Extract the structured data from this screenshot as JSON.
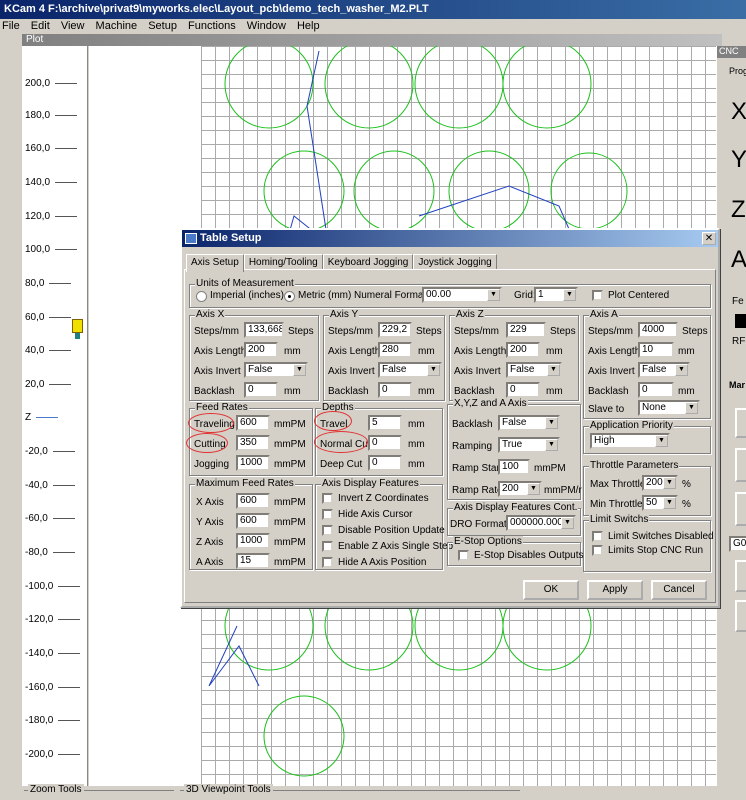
{
  "app": {
    "title": "KCam 4  F:\\archive\\privat9\\myworks.elec\\Layout_pcb\\demo_tech_washer_M2.PLT"
  },
  "menu": [
    "File",
    "Edit",
    "View",
    "Machine",
    "Setup",
    "Functions",
    "Window",
    "Help"
  ],
  "plot": {
    "title": "Plot",
    "ticks": [
      "200,0",
      "180,0",
      "160,0",
      "140,0",
      "120,0",
      "100,0",
      "80,0",
      "60,0",
      "40,0",
      "20,0",
      "Z",
      "-20,0",
      "-40,0",
      "-60,0",
      "-80,0",
      "-100,0",
      "-120,0",
      "-140,0",
      "-160,0",
      "-180,0",
      "-200,0"
    ]
  },
  "right_panel": {
    "title": "CNC",
    "prog": "Prog",
    "axes": [
      "X",
      "Y",
      "Z",
      "A"
    ],
    "fe": "Fe",
    "rf": "RF",
    "ma": "Mar",
    "g0": "G0"
  },
  "bottom": {
    "zoom_tools": "Zoom Tools",
    "viewpoint_tools": "3D Viewpoint Tools"
  },
  "dialog": {
    "title": "Table Setup",
    "tabs": [
      "Axis Setup",
      "Homing/Tooling",
      "Keyboard Jogging",
      "Joystick Jogging"
    ],
    "units": {
      "legend": "Units of Measurement",
      "imperial": "Imperial (inches)",
      "metric": "Metric (mm)",
      "numeral_label": "Numeral Format:",
      "numeral_value": "00.00",
      "grid_label": "Grid:",
      "grid_value": "1",
      "plot_centered": "Plot Centered"
    },
    "axis_x": {
      "legend": "Axis X",
      "steps_label": "Steps/mm",
      "steps": "133,668",
      "steps_unit": "Steps",
      "length_label": "Axis Length",
      "length": "200",
      "length_unit": "mm",
      "invert_label": "Axis Invert",
      "invert": "False",
      "backlash_label": "Backlash",
      "backlash": "0",
      "backlash_unit": "mm"
    },
    "axis_y": {
      "legend": "Axis Y",
      "steps_label": "Steps/mm",
      "steps": "229,2",
      "steps_unit": "Steps",
      "length_label": "Axis Length",
      "length": "280",
      "length_unit": "mm",
      "invert_label": "Axis Invert",
      "invert": "False",
      "backlash_label": "Backlash",
      "backlash": "0",
      "backlash_unit": "mm"
    },
    "axis_z": {
      "legend": "Axis Z",
      "steps_label": "Steps/mm",
      "steps": "229",
      "steps_unit": "Steps",
      "length_label": "Axis Length",
      "length": "200",
      "length_unit": "mm",
      "invert_label": "Axis Invert",
      "invert": "False",
      "backlash_label": "Backlash",
      "backlash": "0",
      "backlash_unit": "mm"
    },
    "axis_a": {
      "legend": "Axis A",
      "steps_label": "Steps/mm",
      "steps": "4000",
      "steps_unit": "Steps",
      "length_label": "Axis Length",
      "length": "10",
      "length_unit": "mm",
      "invert_label": "Axis Invert",
      "invert": "False",
      "backlash_label": "Backlash",
      "backlash": "0",
      "backlash_unit": "mm",
      "slave_label": "Slave to",
      "slave": "None"
    },
    "feed": {
      "legend": "Feed Rates",
      "traveling_label": "Traveling",
      "traveling": "600",
      "cutting_label": "Cutting",
      "cutting": "350",
      "jogging_label": "Jogging",
      "jogging": "1000",
      "unit": "mmPM"
    },
    "depths": {
      "legend": "Depths",
      "travel_label": "Travel",
      "travel": "5",
      "normal_label": "Normal Cut",
      "normal": "0",
      "deep_label": "Deep Cut",
      "deep": "0",
      "unit": "mm"
    },
    "xyz_a": {
      "legend": "X,Y,Z and A Axis",
      "backlash_label": "Backlash",
      "backlash": "False",
      "ramping_label": "Ramping",
      "ramping": "True",
      "ramp_start_label": "Ramp Start",
      "ramp_start": "100",
      "ramp_start_unit": "mmPM",
      "ramp_rate_label": "Ramp Rate",
      "ramp_rate": "200",
      "ramp_rate_unit": "mmPM/r"
    },
    "priority": {
      "legend": "Application Priority",
      "value": "High"
    },
    "throttle": {
      "legend": "Throttle Parameters",
      "max_label": "Max Throttle:",
      "max": "200",
      "min_label": "Min Throttle:",
      "min": "50",
      "unit": "%"
    },
    "max_feed": {
      "legend": "Maximum Feed Rates",
      "x_label": "X Axis",
      "x": "600",
      "y_label": "Y Axis",
      "y": "600",
      "z_label": "Z Axis",
      "z": "1000",
      "a_label": "A Axis",
      "a": "15",
      "unit": "mmPM"
    },
    "display": {
      "legend": "Axis Display Features",
      "opt1": "Invert Z Coordinates",
      "opt2": "Hide Axis Cursor",
      "opt3": "Disable Position Update",
      "opt4": "Enable Z Axis Single Step",
      "opt5": "Hide A Axis Position"
    },
    "display_cont": {
      "legend": "Axis Display Features Cont.",
      "dro_label": "DRO Format",
      "dro": "000000.000"
    },
    "estop": {
      "legend": "E-Stop Options",
      "opt": "E-Stop Disables Outputs"
    },
    "limits": {
      "legend": "Limit Switchs",
      "opt1": "Limit Switches Disabled",
      "opt2": "Limits Stop CNC Run"
    },
    "buttons": {
      "ok": "OK",
      "apply": "Apply",
      "cancel": "Cancel"
    }
  }
}
